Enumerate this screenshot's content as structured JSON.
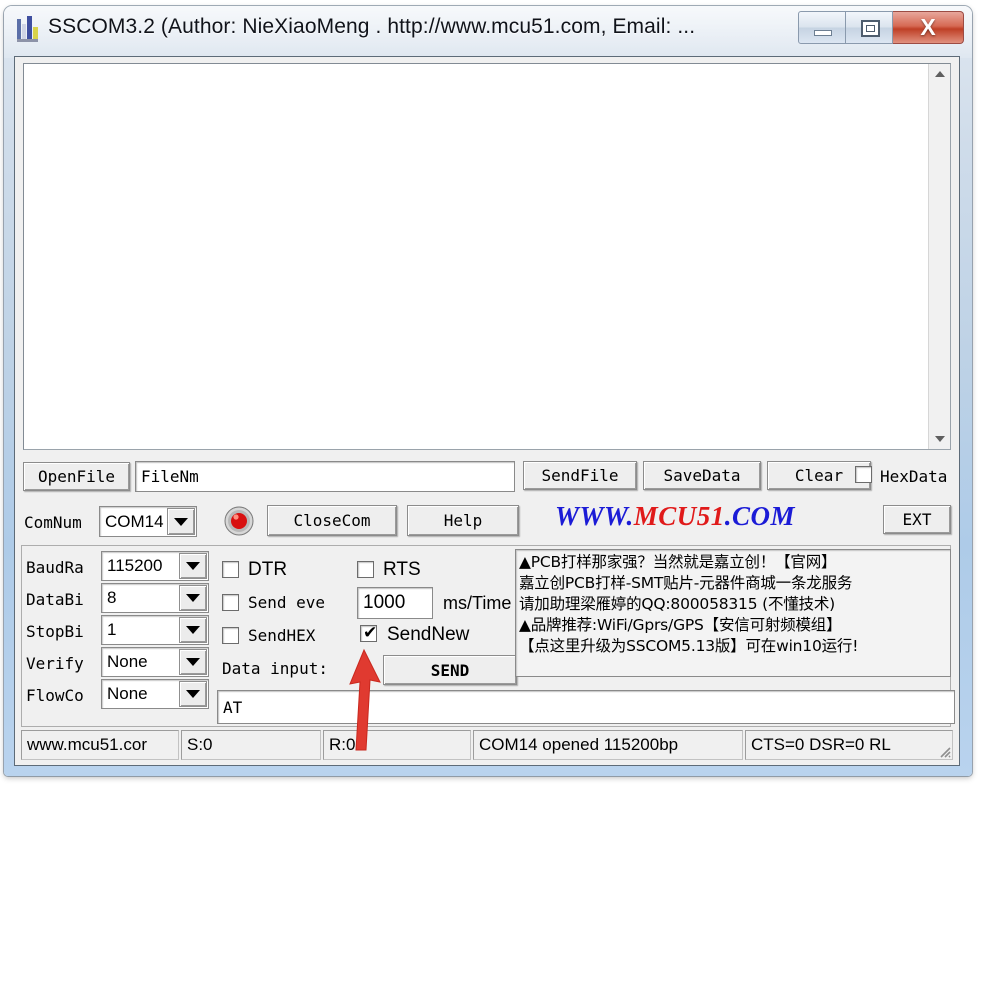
{
  "window": {
    "title": "SSCOM3.2 (Author: NieXiaoMeng . http://www.mcu51.com, Email: ...",
    "icon": "app-icon",
    "minimize_label": "",
    "maximize_label": "",
    "close_label": "X"
  },
  "receive": {
    "content": "",
    "scroll_up_icon": "scroll-up-arrow",
    "scroll_down_icon": "scroll-down-arrow"
  },
  "file_row": {
    "open_file_label": "OpenFile",
    "file_name_value": "FileNm",
    "send_file_label": "SendFile",
    "save_data_label": "SaveData",
    "clear_label": "Clear",
    "hex_data_label": "HexData",
    "hex_data_checked": false
  },
  "com_row": {
    "com_num_label": "ComNum",
    "com_port_value": "COM14",
    "led_icon": "red-led-indicator",
    "close_com_label": "CloseCom",
    "help_label": "Help",
    "logo_parts": {
      "prefix": "WWW.",
      "brand": "MCU51",
      "suffix": ".COM"
    },
    "ext_label": "EXT"
  },
  "settings": {
    "baud_label": "BaudRa",
    "baud_value": "115200",
    "data_bits_label": "DataBi",
    "data_bits_value": "8",
    "stop_bits_label": "StopBi",
    "stop_bits_value": "1",
    "verify_label": "Verify",
    "verify_value": "None",
    "flow_label": "FlowCo",
    "flow_value": "None"
  },
  "controls": {
    "dtr_label": "DTR",
    "dtr_checked": false,
    "rts_label": "RTS",
    "rts_checked": false,
    "send_every_label": "Send eve",
    "send_every_checked": false,
    "interval_value": "1000",
    "interval_unit": "ms/Time",
    "send_hex_label": "SendHEX",
    "send_hex_checked": false,
    "send_new_label": "SendNew",
    "send_new_checked": true,
    "data_input_label": "Data input:",
    "send_button_label": "SEND",
    "data_input_value": "AT"
  },
  "ad_panel": {
    "lines": [
      "▲PCB打样那家强？当然就是嘉立创！【官网】",
      "嘉立创PCB打样-SMT贴片-元器件商城一条龙服务",
      "请加助理梁雁婷的QQ:800058315 (不懂技术)",
      "▲品牌推荐:WiFi/Gprs/GPS【安信可射频模组】",
      "【点这里升级为SSCOM5.13版】可在win10运行!"
    ]
  },
  "status_bar": {
    "panels": [
      "www.mcu51.cor",
      "S:0",
      "R:0",
      "COM14 opened 115200bp",
      "CTS=0 DSR=0 RL"
    ],
    "grip_icon": "resize-grip-icon"
  },
  "annotation": {
    "arrow_icon": "red-up-arrow-annotation",
    "color": "#e03a30",
    "points_to": "SendNew checkbox"
  },
  "colors": {
    "accent_blue": "#1b1bd6",
    "accent_red": "#e01a1a",
    "window_glass": "#bed2e6",
    "close_button": "#bf3f26",
    "led_on": "#d81010"
  }
}
